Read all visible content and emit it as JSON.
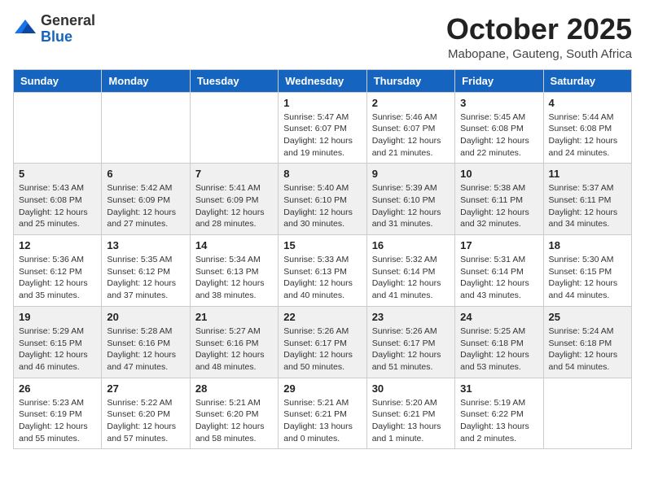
{
  "header": {
    "logo": {
      "line1": "General",
      "line2": "Blue"
    },
    "title": "October 2025",
    "location": "Mabopane, Gauteng, South Africa"
  },
  "calendar": {
    "headers": [
      "Sunday",
      "Monday",
      "Tuesday",
      "Wednesday",
      "Thursday",
      "Friday",
      "Saturday"
    ],
    "weeks": [
      [
        {
          "day": "",
          "info": ""
        },
        {
          "day": "",
          "info": ""
        },
        {
          "day": "",
          "info": ""
        },
        {
          "day": "1",
          "info": "Sunrise: 5:47 AM\nSunset: 6:07 PM\nDaylight: 12 hours\nand 19 minutes."
        },
        {
          "day": "2",
          "info": "Sunrise: 5:46 AM\nSunset: 6:07 PM\nDaylight: 12 hours\nand 21 minutes."
        },
        {
          "day": "3",
          "info": "Sunrise: 5:45 AM\nSunset: 6:08 PM\nDaylight: 12 hours\nand 22 minutes."
        },
        {
          "day": "4",
          "info": "Sunrise: 5:44 AM\nSunset: 6:08 PM\nDaylight: 12 hours\nand 24 minutes."
        }
      ],
      [
        {
          "day": "5",
          "info": "Sunrise: 5:43 AM\nSunset: 6:08 PM\nDaylight: 12 hours\nand 25 minutes."
        },
        {
          "day": "6",
          "info": "Sunrise: 5:42 AM\nSunset: 6:09 PM\nDaylight: 12 hours\nand 27 minutes."
        },
        {
          "day": "7",
          "info": "Sunrise: 5:41 AM\nSunset: 6:09 PM\nDaylight: 12 hours\nand 28 minutes."
        },
        {
          "day": "8",
          "info": "Sunrise: 5:40 AM\nSunset: 6:10 PM\nDaylight: 12 hours\nand 30 minutes."
        },
        {
          "day": "9",
          "info": "Sunrise: 5:39 AM\nSunset: 6:10 PM\nDaylight: 12 hours\nand 31 minutes."
        },
        {
          "day": "10",
          "info": "Sunrise: 5:38 AM\nSunset: 6:11 PM\nDaylight: 12 hours\nand 32 minutes."
        },
        {
          "day": "11",
          "info": "Sunrise: 5:37 AM\nSunset: 6:11 PM\nDaylight: 12 hours\nand 34 minutes."
        }
      ],
      [
        {
          "day": "12",
          "info": "Sunrise: 5:36 AM\nSunset: 6:12 PM\nDaylight: 12 hours\nand 35 minutes."
        },
        {
          "day": "13",
          "info": "Sunrise: 5:35 AM\nSunset: 6:12 PM\nDaylight: 12 hours\nand 37 minutes."
        },
        {
          "day": "14",
          "info": "Sunrise: 5:34 AM\nSunset: 6:13 PM\nDaylight: 12 hours\nand 38 minutes."
        },
        {
          "day": "15",
          "info": "Sunrise: 5:33 AM\nSunset: 6:13 PM\nDaylight: 12 hours\nand 40 minutes."
        },
        {
          "day": "16",
          "info": "Sunrise: 5:32 AM\nSunset: 6:14 PM\nDaylight: 12 hours\nand 41 minutes."
        },
        {
          "day": "17",
          "info": "Sunrise: 5:31 AM\nSunset: 6:14 PM\nDaylight: 12 hours\nand 43 minutes."
        },
        {
          "day": "18",
          "info": "Sunrise: 5:30 AM\nSunset: 6:15 PM\nDaylight: 12 hours\nand 44 minutes."
        }
      ],
      [
        {
          "day": "19",
          "info": "Sunrise: 5:29 AM\nSunset: 6:15 PM\nDaylight: 12 hours\nand 46 minutes."
        },
        {
          "day": "20",
          "info": "Sunrise: 5:28 AM\nSunset: 6:16 PM\nDaylight: 12 hours\nand 47 minutes."
        },
        {
          "day": "21",
          "info": "Sunrise: 5:27 AM\nSunset: 6:16 PM\nDaylight: 12 hours\nand 48 minutes."
        },
        {
          "day": "22",
          "info": "Sunrise: 5:26 AM\nSunset: 6:17 PM\nDaylight: 12 hours\nand 50 minutes."
        },
        {
          "day": "23",
          "info": "Sunrise: 5:26 AM\nSunset: 6:17 PM\nDaylight: 12 hours\nand 51 minutes."
        },
        {
          "day": "24",
          "info": "Sunrise: 5:25 AM\nSunset: 6:18 PM\nDaylight: 12 hours\nand 53 minutes."
        },
        {
          "day": "25",
          "info": "Sunrise: 5:24 AM\nSunset: 6:18 PM\nDaylight: 12 hours\nand 54 minutes."
        }
      ],
      [
        {
          "day": "26",
          "info": "Sunrise: 5:23 AM\nSunset: 6:19 PM\nDaylight: 12 hours\nand 55 minutes."
        },
        {
          "day": "27",
          "info": "Sunrise: 5:22 AM\nSunset: 6:20 PM\nDaylight: 12 hours\nand 57 minutes."
        },
        {
          "day": "28",
          "info": "Sunrise: 5:21 AM\nSunset: 6:20 PM\nDaylight: 12 hours\nand 58 minutes."
        },
        {
          "day": "29",
          "info": "Sunrise: 5:21 AM\nSunset: 6:21 PM\nDaylight: 13 hours\nand 0 minutes."
        },
        {
          "day": "30",
          "info": "Sunrise: 5:20 AM\nSunset: 6:21 PM\nDaylight: 13 hours\nand 1 minute."
        },
        {
          "day": "31",
          "info": "Sunrise: 5:19 AM\nSunset: 6:22 PM\nDaylight: 13 hours\nand 2 minutes."
        },
        {
          "day": "",
          "info": ""
        }
      ]
    ]
  }
}
